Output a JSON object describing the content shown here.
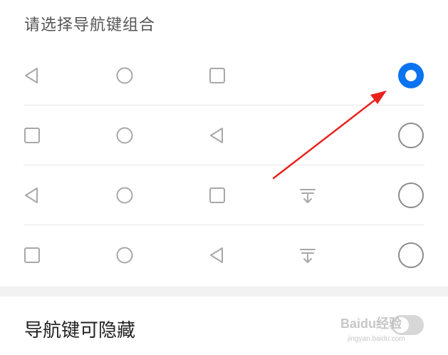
{
  "section_title": "请选择导航键组合",
  "rows": [
    {
      "icons": [
        "back-triangle-icon",
        "home-circle-icon",
        "recents-square-icon"
      ],
      "selected": true
    },
    {
      "icons": [
        "recents-square-icon",
        "home-circle-icon",
        "back-triangle-icon"
      ],
      "selected": false
    },
    {
      "icons": [
        "back-triangle-icon",
        "home-circle-icon",
        "recents-square-icon",
        "notification-pulldown-icon"
      ],
      "selected": false
    },
    {
      "icons": [
        "recents-square-icon",
        "home-circle-icon",
        "back-triangle-icon",
        "notification-pulldown-icon"
      ],
      "selected": false
    }
  ],
  "hideable_setting": {
    "label": "导航键可隐藏",
    "enabled": false
  },
  "colors": {
    "accent": "#0a73f0",
    "icon": "#a8a8a8",
    "annotation_arrow": "#e8231f"
  },
  "watermark": {
    "text": "Baidu经验",
    "sub": "jingyan.baidu.com"
  }
}
